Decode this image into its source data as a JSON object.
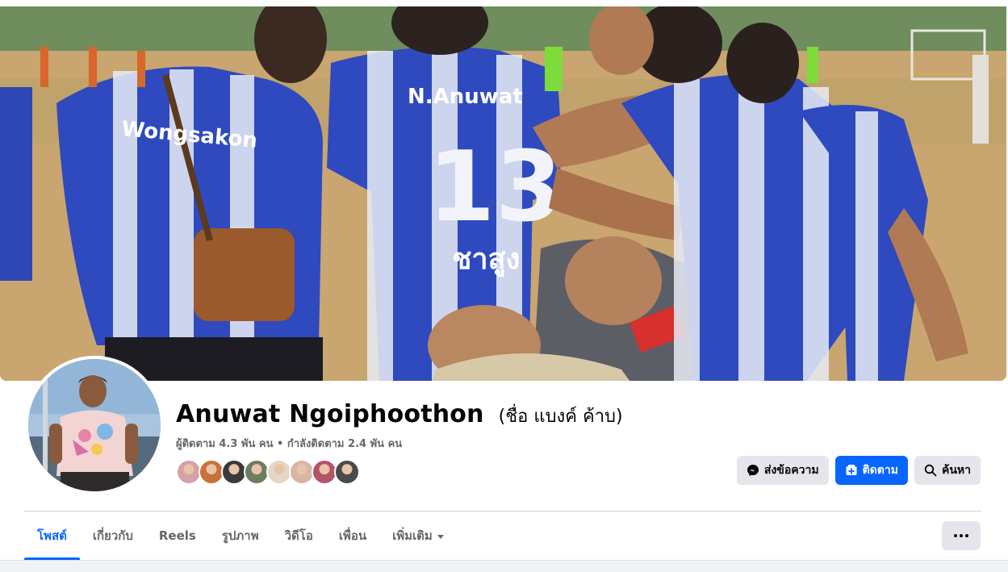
{
  "profile": {
    "name": "Anuwat Ngoiphoothon",
    "alt_name": "(ชื่อ แบงค์ ค้าบ)",
    "stats": "ผู้ติดตาม 4.3 พัน คน • กำลังติดตาม 2.4 พัน คน"
  },
  "follower_avatar_colors": [
    "#d6a2a8",
    "#c9713b",
    "#3a3a3a",
    "#6b7f5e",
    "#e5d6c8",
    "#d8b6a6",
    "#b4546a",
    "#4a4a4a"
  ],
  "actions": {
    "message_label": "ส่งข้อความ",
    "follow_label": "ติดตาม",
    "search_label": "ค้นหา"
  },
  "tabs": [
    {
      "label": "โพสต์",
      "active": true
    },
    {
      "label": "เกี่ยวกับ"
    },
    {
      "label": "Reels"
    },
    {
      "label": "รูปภาพ"
    },
    {
      "label": "วิดีโอ"
    },
    {
      "label": "เพื่อน"
    },
    {
      "label": "เพิ่มเติม"
    }
  ],
  "cover_jersey_texts": [
    "Wongsakon",
    "N.Anuwat",
    "13",
    "ชาสูง"
  ],
  "icons": {
    "message": "messenger-icon",
    "follow": "follow-icon",
    "search": "search-icon",
    "more": "more-options-icon",
    "dropdown": "caret-down-icon"
  },
  "colors": {
    "accent": "#0866ff",
    "secondary_text": "#65676b",
    "button_gray": "#e4e6eb"
  }
}
